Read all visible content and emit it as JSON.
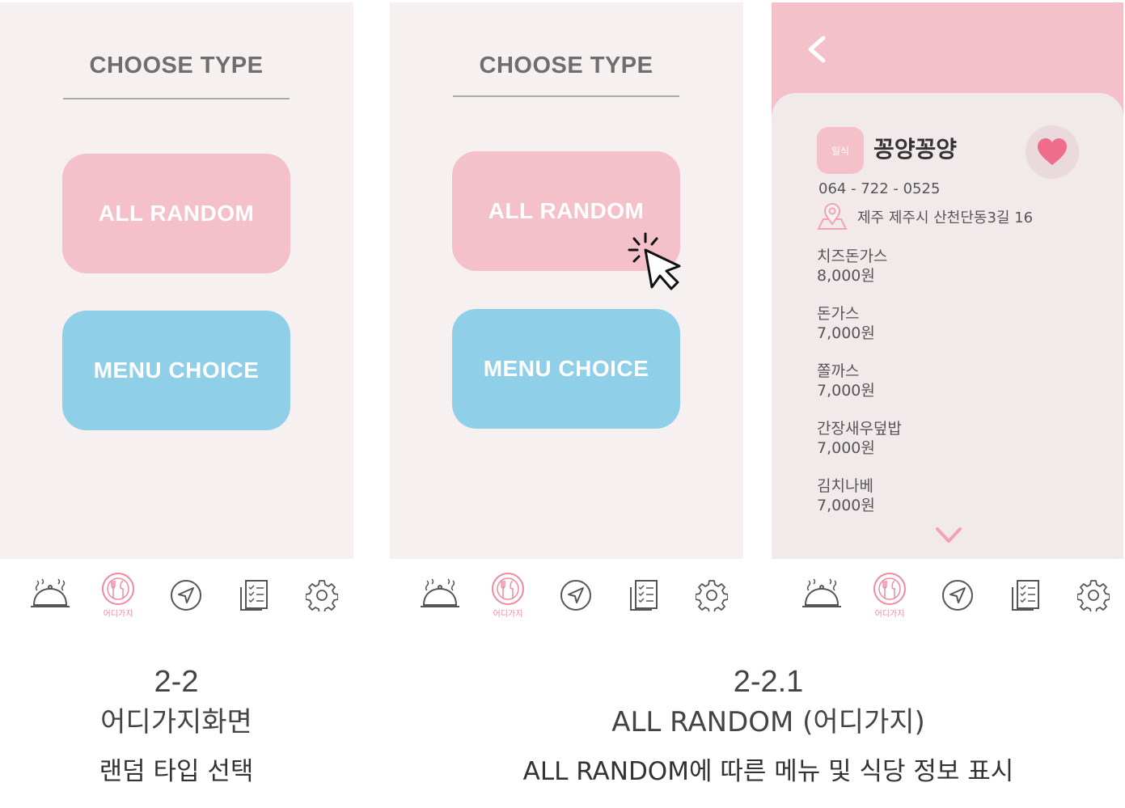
{
  "screens": [
    {
      "title": "CHOOSE TYPE",
      "buttons": {
        "random": "ALL RANDOM",
        "menu": "MENU CHOICE"
      }
    },
    {
      "title": "CHOOSE TYPE",
      "buttons": {
        "random": "ALL RANDOM",
        "menu": "MENU CHOICE"
      }
    }
  ],
  "detail": {
    "category": "일식",
    "name": "꽁양꽁양",
    "phone": "064 - 722 - 0525",
    "address": "제주 제주시 산천단동3길 16",
    "menu": [
      {
        "name": "치즈돈가스",
        "price": "8,000원"
      },
      {
        "name": "돈가스",
        "price": "7,000원"
      },
      {
        "name": "쫄까스",
        "price": "7,000원"
      },
      {
        "name": "간장새우덮밥",
        "price": "7,000원"
      },
      {
        "name": "김치나베",
        "price": "7,000원"
      }
    ]
  },
  "nav": {
    "items": [
      "restaurant-icon",
      "random-dining-icon",
      "navigation-icon",
      "checklist-icon",
      "settings-icon"
    ],
    "active_label": "어디가지"
  },
  "captions": {
    "left": {
      "number": "2-2",
      "title": "어디가지화면",
      "subtitle": "랜덤 타입 선택"
    },
    "right": {
      "number": "2-2.1",
      "title": "ALL RANDOM (어디가지)",
      "subtitle": "ALL RANDOM에 따른 메뉴 및 식당 정보 표시"
    }
  },
  "colors": {
    "pink": "#f4c1cb",
    "blue": "#8fd0e8",
    "heart": "#ee6d8a",
    "active_nav": "#ef8aa0",
    "screen_bg": "#f7f0f1"
  }
}
